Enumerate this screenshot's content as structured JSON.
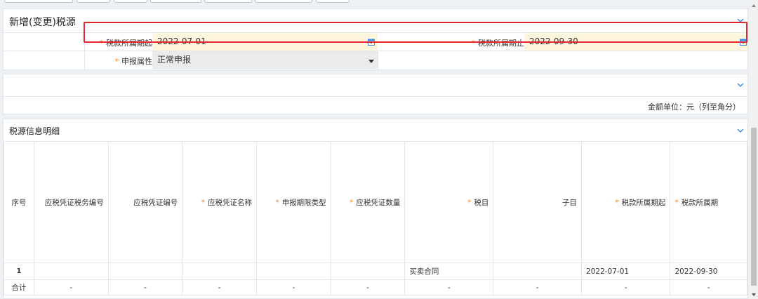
{
  "section1": {
    "title": "新增(变更)税源",
    "period_start": {
      "label": "税款所属期起",
      "value": "2022-07-01"
    },
    "period_end": {
      "label": "税款所属期止",
      "value": "2022-09-30"
    },
    "declare_attr": {
      "label": "申报属性",
      "value": "正常申报"
    }
  },
  "section2": {
    "unit_note": "金额单位：元（列至角分）"
  },
  "section3": {
    "title": "税源信息明细",
    "required_mark": "*",
    "columns": [
      "序号",
      "应税凭证税务编号",
      "应税凭证编号",
      "应税凭证名称",
      "申报期限类型",
      "应税凭证数量",
      "税目",
      "子目",
      "税款所属期起",
      "税款所属期"
    ],
    "required_columns": [
      false,
      false,
      false,
      true,
      true,
      true,
      true,
      false,
      true,
      true
    ],
    "row1": [
      "1",
      "",
      "",
      "",
      "",
      "",
      "买卖合同",
      "",
      "2022-07-01",
      "2022-09-30"
    ],
    "total_row": [
      "合计",
      "-",
      "-",
      "-",
      "-",
      "-",
      "-",
      "-",
      "-",
      "-"
    ]
  },
  "colors": {
    "required_star": "#f08a24",
    "highlight_border": "#e0282e",
    "field_yellow": "#fdf6dc",
    "field_gray": "#ebebeb",
    "chevron": "#3a8ee6"
  }
}
